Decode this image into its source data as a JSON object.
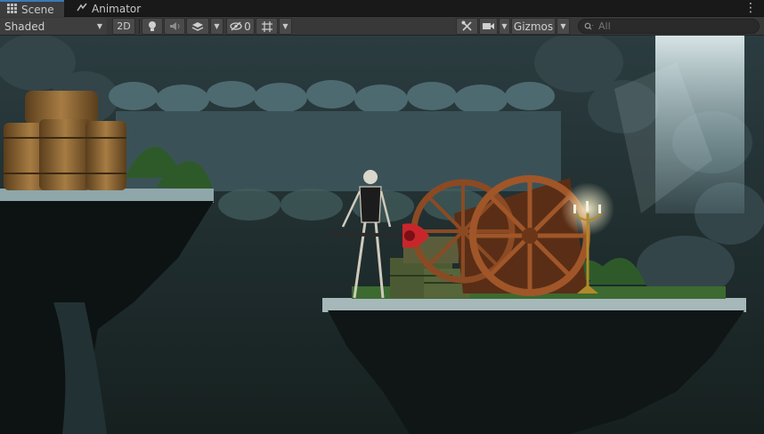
{
  "tabs": [
    {
      "label": "Scene",
      "icon": "scene-grid-icon",
      "active": true
    },
    {
      "label": "Animator",
      "icon": "animator-icon",
      "active": false
    }
  ],
  "toolbar": {
    "draw_mode": "Shaded",
    "mode_2d": "2D",
    "hidden_count": "0",
    "gizmos": "Gizmos",
    "search_placeholder": "All"
  },
  "colors": {
    "active_tab_accent": "#3a79bb",
    "toolbar_bg": "#383838",
    "tab_bar_bg": "#191919"
  }
}
